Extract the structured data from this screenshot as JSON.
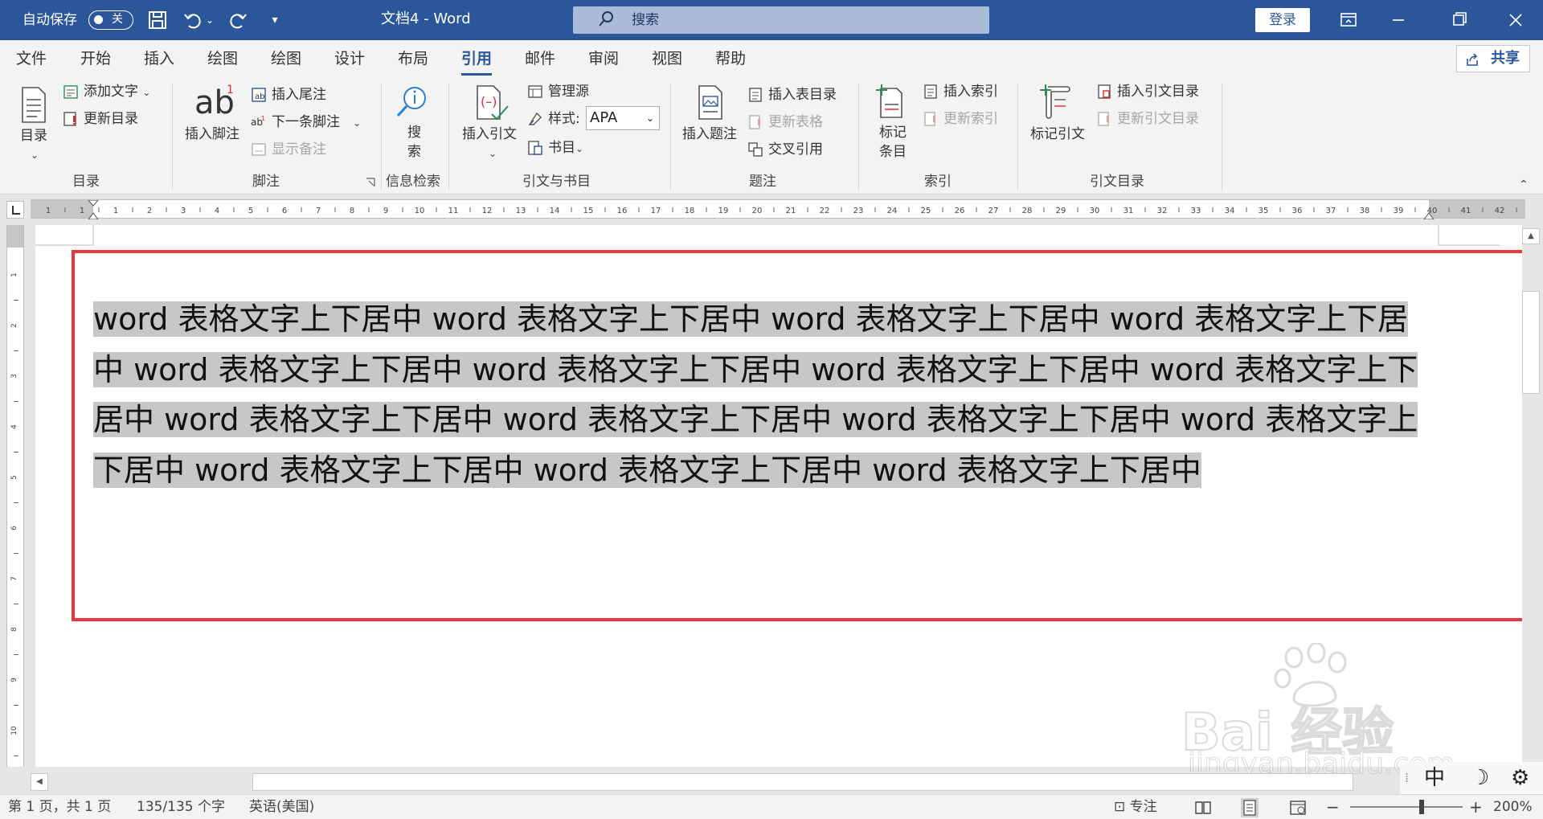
{
  "titlebar": {
    "autosave_label": "自动保存",
    "autosave_state": "关",
    "doc_title": "文档4  -  Word",
    "search_placeholder": "搜索",
    "login_label": "登录",
    "accent": "#2b579a"
  },
  "tabs": [
    {
      "label": "文件"
    },
    {
      "label": "开始"
    },
    {
      "label": "插入"
    },
    {
      "label": "绘图"
    },
    {
      "label": "绘图"
    },
    {
      "label": "设计"
    },
    {
      "label": "布局"
    },
    {
      "label": "引用",
      "active": true
    },
    {
      "label": "邮件"
    },
    {
      "label": "审阅"
    },
    {
      "label": "视图"
    },
    {
      "label": "帮助"
    }
  ],
  "share_label": "共享",
  "ribbon": {
    "toc": {
      "big": "目录",
      "add_text": "添加文字",
      "update": "更新目录",
      "group": "目录"
    },
    "footnotes": {
      "insert_footnote": "插入脚注",
      "insert_endnote": "插入尾注",
      "next_footnote": "下一条脚注",
      "show_notes": "显示备注",
      "group": "脚注",
      "ab_glyph": "ab",
      "sup": "1"
    },
    "research": {
      "search": "搜索",
      "search_l1": "搜",
      "search_l2": "索",
      "group": "信息检索"
    },
    "citations": {
      "insert_citation": "插入引文",
      "manage_sources": "管理源",
      "style_label": "样式:",
      "style_value": "APA",
      "bibliography": "书目",
      "group": "引文与书目"
    },
    "captions": {
      "insert_caption": "插入题注",
      "insert_table_of_figures": "插入表目录",
      "update_table": "更新表格",
      "cross_reference": "交叉引用",
      "group": "题注"
    },
    "index": {
      "mark_entry_l1": "标记",
      "mark_entry_l2": "条目",
      "insert_index": "插入索引",
      "update_index": "更新索引",
      "group": "索引"
    },
    "toa": {
      "mark_citation": "标记引文",
      "insert_toa": "插入引文目录",
      "update_toa": "更新引文目录",
      "group": "引文目录"
    }
  },
  "ruler": {
    "numbers": [
      1,
      1,
      1,
      2,
      3,
      4,
      5,
      6,
      7,
      8,
      9,
      10,
      11,
      12,
      13,
      14,
      15,
      16,
      17,
      18,
      19,
      20,
      21,
      22,
      23,
      24,
      25,
      26,
      27,
      28,
      29,
      30,
      31,
      32,
      33,
      34,
      35,
      36,
      37,
      38,
      39,
      40,
      41,
      42
    ],
    "vnumbers": [
      1,
      2,
      3,
      4,
      5,
      6,
      7,
      8,
      9,
      10
    ]
  },
  "document": {
    "lines": [
      "word 表格文字上下居中 word 表格文字上下居中 word 表格文字上下居中 word 表格文字上下居",
      "中 word 表格文字上下居中 word 表格文字上下居中 word 表格文字上下居中 word 表格文字上下",
      "居中 word 表格文字上下居中 word 表格文字上下居中 word 表格文字上下居中 word 表格文字上",
      "下居中 word 表格文字上下居中 word 表格文字上下居中 word 表格文字上下居中"
    ],
    "highlight_color": "#c7c7c7",
    "annotation_color": "#e8393d"
  },
  "ime": {
    "mode": "中"
  },
  "watermark": {
    "brand": "Bai 经验",
    "url": "jingyan.baidu.com"
  },
  "statusbar": {
    "page": "第 1 页，共 1 页",
    "words": "135/135 个字",
    "language": "英语(美国)",
    "focus": "专注",
    "zoom_minus": "−",
    "zoom_plus": "+",
    "zoom": "200%"
  }
}
